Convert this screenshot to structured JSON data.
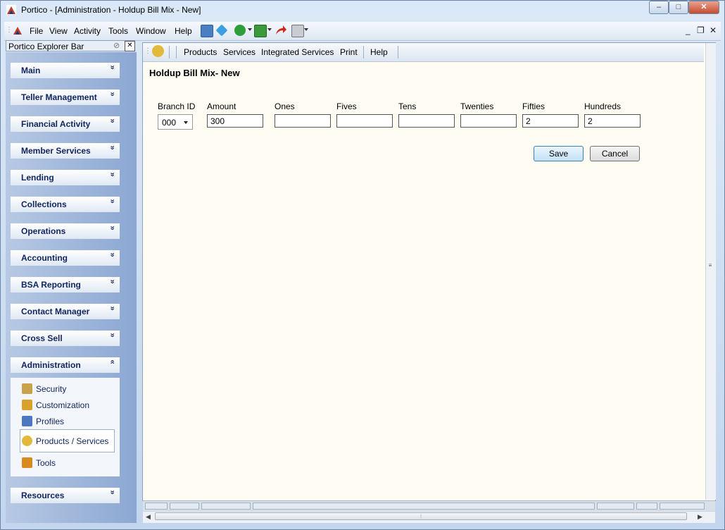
{
  "window": {
    "title": "Portico - [Administration - Holdup Bill Mix - New]",
    "min_glyph": "–",
    "max_glyph": "□",
    "close_glyph": "✕"
  },
  "menubar": {
    "items": [
      "File",
      "View",
      "Activity",
      "Tools",
      "Window",
      "Help"
    ],
    "mdi_min": "_",
    "mdi_restore": "❐",
    "mdi_close": "✕"
  },
  "explorer": {
    "title": "Portico Explorer Bar",
    "groups": [
      "Main",
      "Teller Management",
      "Financial Activity",
      "Member Services",
      "Lending",
      "Collections",
      "Operations",
      "Accounting",
      "BSA Reporting",
      "Contact Manager",
      "Cross Sell",
      "Administration",
      "Resources"
    ],
    "expand_glyph": "»",
    "collapse_glyph": "«",
    "admin_items": [
      "Security",
      "Customization",
      "Profiles",
      "Products / Services",
      "Tools"
    ]
  },
  "subtoolbar": {
    "items": [
      "Products",
      "Services",
      "Integrated Services",
      "Print",
      "Help"
    ]
  },
  "form": {
    "title": "Holdup Bill Mix- New",
    "labels": [
      "Branch ID",
      "Amount",
      "Ones",
      "Fives",
      "Tens",
      "Twenties",
      "Fifties",
      "Hundreds"
    ],
    "branch_id": "000",
    "amount": "300",
    "ones": "",
    "fives": "",
    "tens": "",
    "twenties": "",
    "fifties": "2",
    "hundreds": "2",
    "save_label": "Save",
    "cancel_label": "Cancel"
  },
  "colors": {
    "accent": "#10245e",
    "content_bg": "#fffdf3",
    "save_border": "#3c7fb1"
  }
}
